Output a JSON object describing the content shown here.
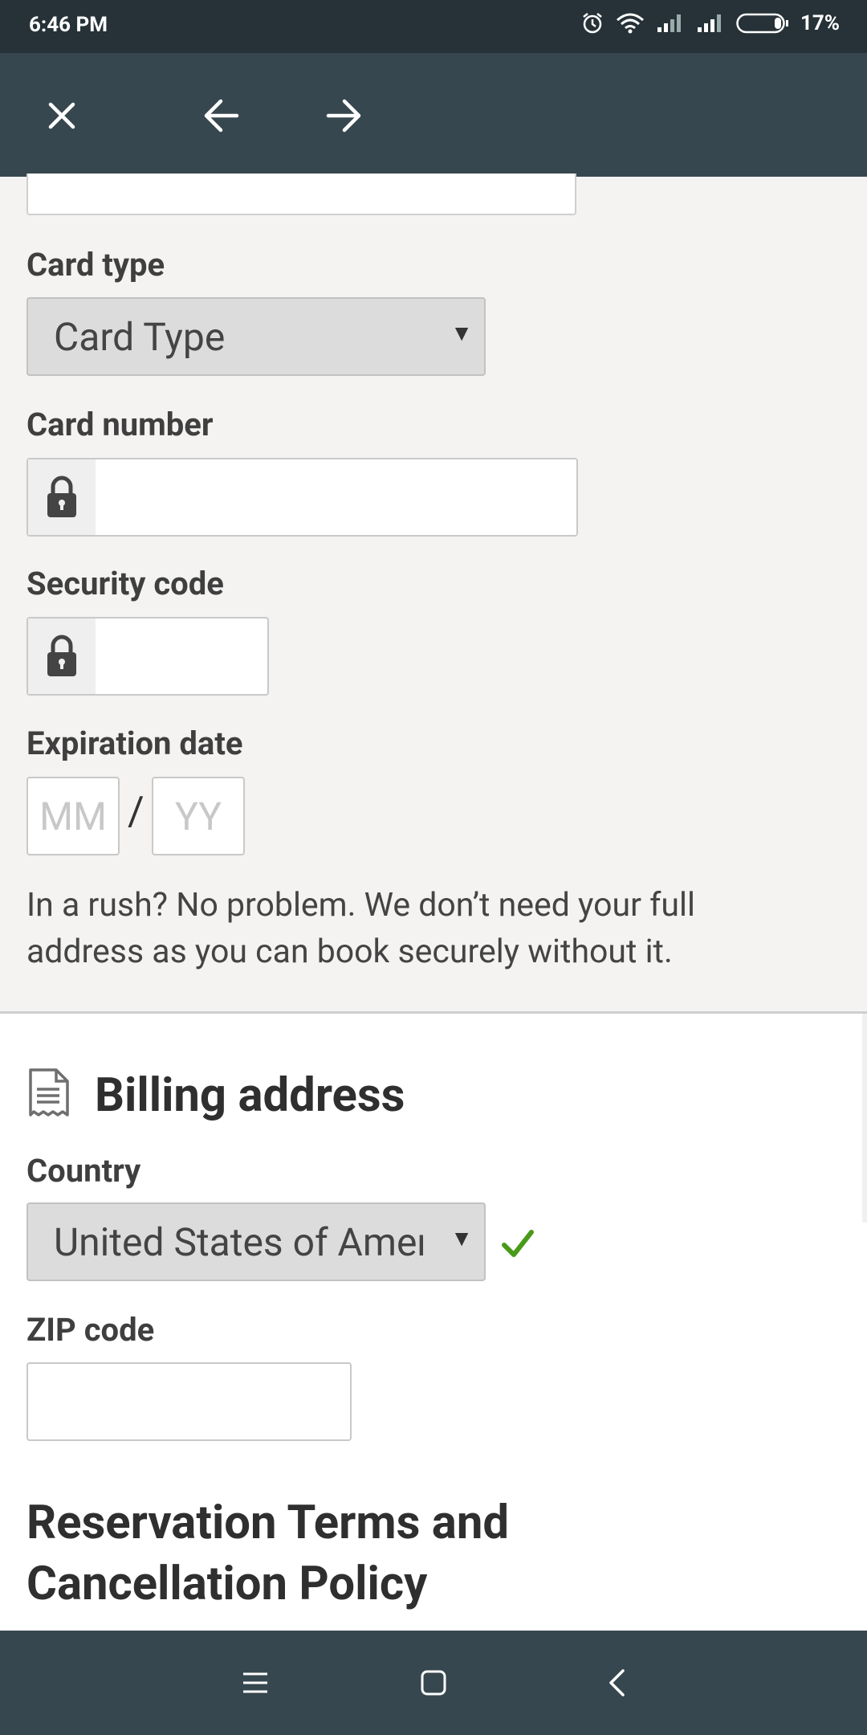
{
  "status_bar": {
    "time": "6:46 PM",
    "battery": "17%",
    "icons": [
      "alarm-icon",
      "wifi-icon",
      "signal-icon",
      "signal-icon",
      "battery-icon"
    ]
  },
  "toolbar": {
    "icons": [
      "close-icon",
      "arrow-left-icon",
      "arrow-right-icon"
    ]
  },
  "payment": {
    "card_type_label": "Card type",
    "card_type_value": "Card Type",
    "card_number_label": "Card number",
    "security_code_label": "Security code",
    "expiration_label": "Expiration date",
    "exp_month_placeholder": "MM",
    "exp_separator": "/",
    "exp_year_placeholder": "YY",
    "info_text": "In a rush? No problem. We don’t need your full address as you can book securely without it."
  },
  "billing": {
    "title": "Billing address",
    "country_label": "Country",
    "country_value": "United States of America",
    "zip_label": "ZIP code"
  },
  "terms": {
    "title": "Reservation Terms and Cancellation Policy"
  },
  "nav_bar": {
    "icons": [
      "menu-icon",
      "home-square-icon",
      "back-chevron-icon"
    ]
  },
  "colors": {
    "status_bar": "#263238",
    "toolbar": "#37474f",
    "form_background": "#f4f3f1",
    "select_background": "#dcdcdc",
    "check_green": "#4a9a1a"
  }
}
